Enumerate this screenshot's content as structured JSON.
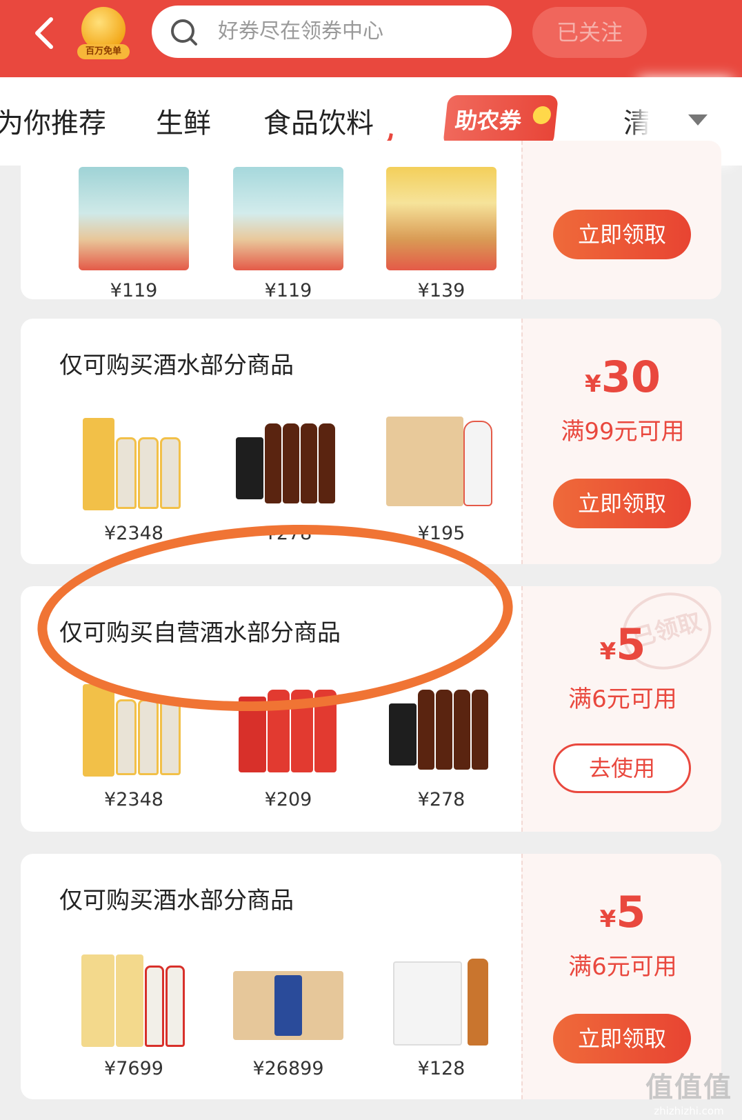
{
  "header": {
    "badge_label": "百万免单",
    "search_placeholder": "好券尽在领券中心",
    "follow_label": "已关注"
  },
  "tabs": {
    "items": [
      "为你推荐",
      "生鲜",
      "食品饮料",
      "助农券",
      "清"
    ]
  },
  "cards": [
    {
      "title": "",
      "products": [
        {
          "price": "¥119"
        },
        {
          "price": "¥119"
        },
        {
          "price": "¥139"
        }
      ],
      "button": "立即领取"
    },
    {
      "title": "仅可购买酒水部分商品",
      "products": [
        {
          "price": "¥2348"
        },
        {
          "price": "¥278"
        },
        {
          "price": "¥195"
        }
      ],
      "amount_yen": "¥",
      "amount": "30",
      "condition": "满99元可用",
      "button": "立即领取"
    },
    {
      "title": "仅可购买自营酒水部分商品",
      "products": [
        {
          "price": "¥2348"
        },
        {
          "price": "¥209"
        },
        {
          "price": "¥278"
        }
      ],
      "amount_yen": "¥",
      "amount": "5",
      "condition": "满6元可用",
      "stamp": "已领取",
      "button": "去使用"
    },
    {
      "title": "仅可购买酒水部分商品",
      "products": [
        {
          "price": "¥7699"
        },
        {
          "price": "¥26899"
        },
        {
          "price": "¥128"
        }
      ],
      "amount_yen": "¥",
      "amount": "5",
      "condition": "满6元可用",
      "button": "立即领取"
    }
  ],
  "watermark": {
    "logo": "值值值",
    "url": "zhizhizhi.com"
  },
  "colors": {
    "brand_red": "#e9483e",
    "annotation_orange": "#f07434"
  }
}
